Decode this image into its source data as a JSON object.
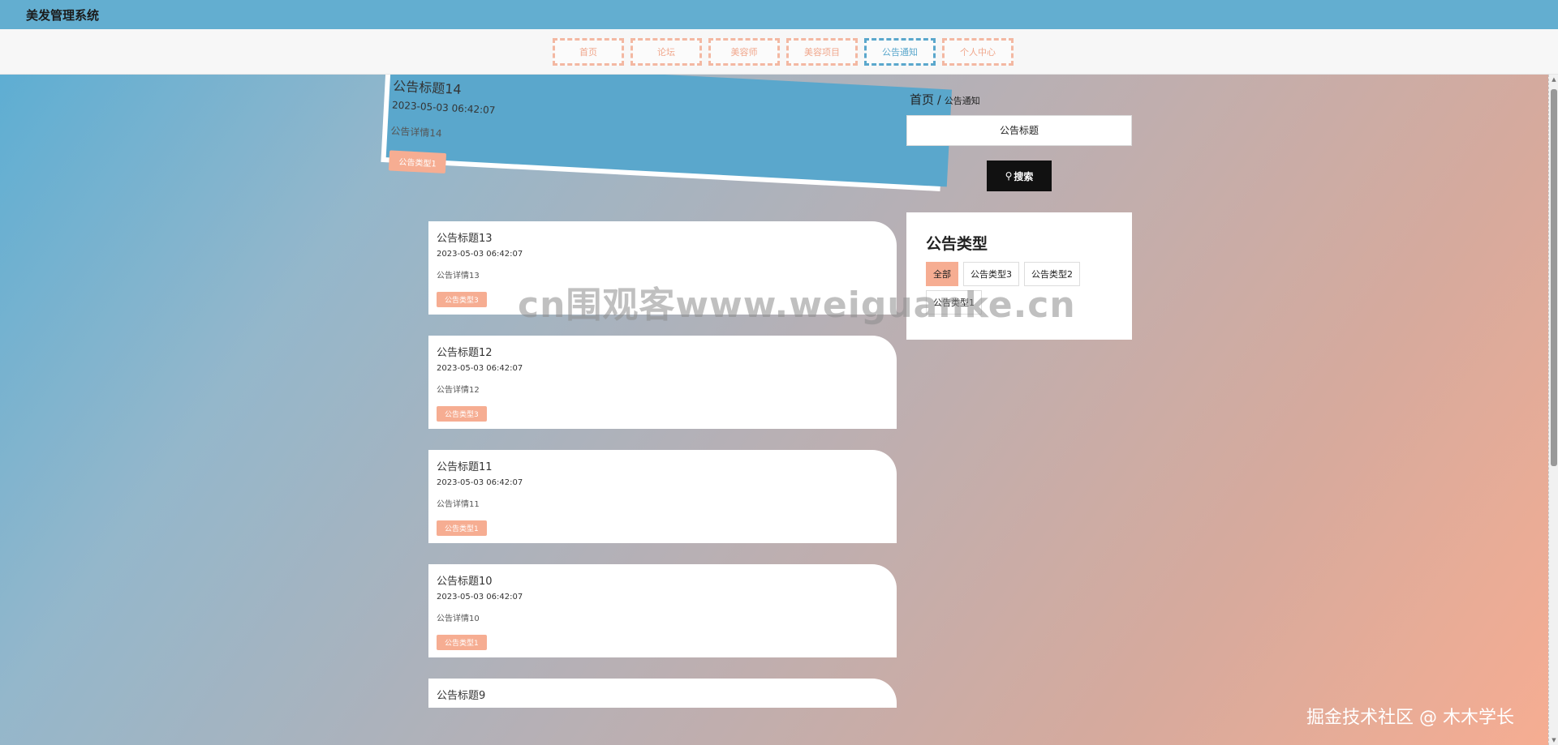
{
  "app": {
    "title": "美发管理系统"
  },
  "nav": {
    "items": [
      {
        "label": "首页",
        "active": false
      },
      {
        "label": "论坛",
        "active": false
      },
      {
        "label": "美容师",
        "active": false
      },
      {
        "label": "美容项目",
        "active": false
      },
      {
        "label": "公告通知",
        "active": true
      },
      {
        "label": "个人中心",
        "active": false
      }
    ]
  },
  "breadcrumb": {
    "home": "首页",
    "separator": "/",
    "current": "公告通知"
  },
  "search": {
    "placeholder": "公告标题",
    "button_label": "搜索",
    "icon": "search-icon"
  },
  "type_filter": {
    "title": "公告类型",
    "tags": [
      {
        "label": "全部",
        "active": true
      },
      {
        "label": "公告类型3",
        "active": false
      },
      {
        "label": "公告类型2",
        "active": false
      },
      {
        "label": "公告类型1",
        "active": false
      }
    ]
  },
  "notices": [
    {
      "title": "公告标题14",
      "date": "2023-05-03 06:42:07",
      "detail": "公告详情14",
      "type": "公告类型1"
    },
    {
      "title": "公告标题13",
      "date": "2023-05-03 06:42:07",
      "detail": "公告详情13",
      "type": "公告类型3"
    },
    {
      "title": "公告标题12",
      "date": "2023-05-03 06:42:07",
      "detail": "公告详情12",
      "type": "公告类型3"
    },
    {
      "title": "公告标题11",
      "date": "2023-05-03 06:42:07",
      "detail": "公告详情11",
      "type": "公告类型1"
    },
    {
      "title": "公告标题10",
      "date": "2023-05-03 06:42:07",
      "detail": "公告详情10",
      "type": "公告类型1"
    },
    {
      "title": "公告标题9"
    }
  ],
  "watermarks": {
    "center": "cn围观客www.weiguanke.cn",
    "corner": "掘金技术社区 @ 木木学长"
  },
  "colors": {
    "topbar": "#63aed0",
    "accent_blue": "#5aa7cc",
    "accent_peach": "#f6ad92",
    "button_dark": "#111111"
  }
}
